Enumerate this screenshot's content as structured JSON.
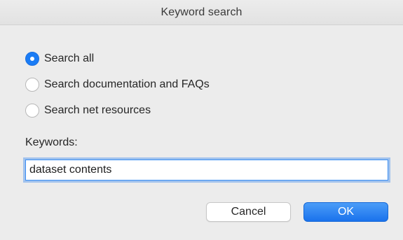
{
  "dialog": {
    "title": "Keyword search"
  },
  "options": [
    {
      "label": "Search all",
      "checked": true
    },
    {
      "label": "Search documentation and FAQs",
      "checked": false
    },
    {
      "label": "Search net resources",
      "checked": false
    }
  ],
  "keywords": {
    "label": "Keywords:",
    "value": "dataset contents"
  },
  "buttons": {
    "cancel_label": "Cancel",
    "ok_label": "OK"
  },
  "colors": {
    "accent": "#1a7cf5",
    "background": "#ececec"
  }
}
